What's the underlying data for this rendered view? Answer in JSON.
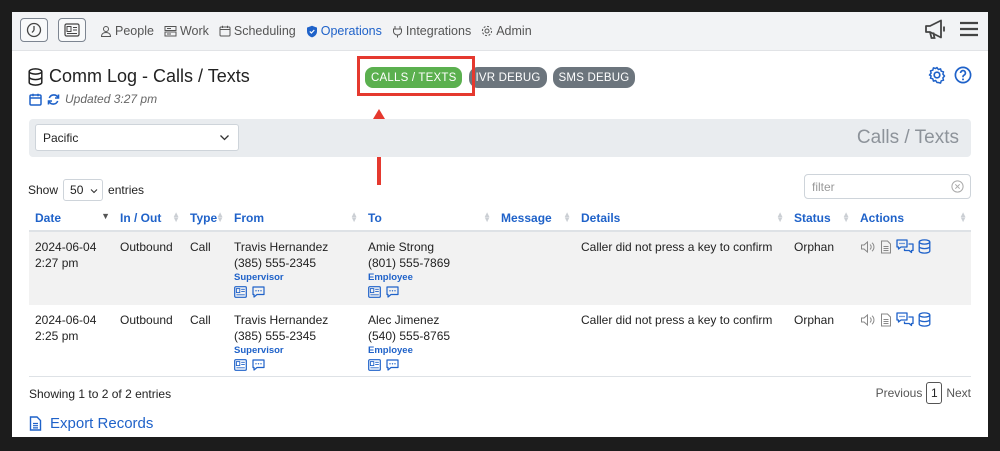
{
  "nav": {
    "items": [
      {
        "label": "People",
        "icon": "person-icon"
      },
      {
        "label": "Work",
        "icon": "work-icon"
      },
      {
        "label": "Scheduling",
        "icon": "calendar-icon"
      },
      {
        "label": "Operations",
        "icon": "shield-icon"
      },
      {
        "label": "Integrations",
        "icon": "plug-icon"
      },
      {
        "label": "Admin",
        "icon": "gear-icon"
      }
    ]
  },
  "header": {
    "title": "Comm Log - Calls / Texts",
    "updated": "Updated 3:27 pm"
  },
  "tabs": {
    "calls": "CALLS / TEXTS",
    "ivr": "IVR DEBUG",
    "sms": "SMS DEBUG"
  },
  "filterbar": {
    "timezone": "Pacific",
    "title": "Calls / Texts"
  },
  "table_controls": {
    "show": "Show",
    "page_length": "50",
    "entries": "entries",
    "filter_placeholder": "filter"
  },
  "table": {
    "columns": [
      "Date",
      "In / Out",
      "Type",
      "From",
      "To",
      "Message",
      "Details",
      "Status",
      "Actions"
    ],
    "rows": [
      {
        "date": "2024-06-04",
        "time": "2:27 pm",
        "direction": "Outbound",
        "type": "Call",
        "from_name": "Travis Hernandez",
        "from_phone": "(385) 555-2345",
        "from_role": "Supervisor",
        "to_name": "Amie Strong",
        "to_phone": "(801) 555-7869",
        "to_role": "Employee",
        "message": "",
        "details": "Caller did not press a key to confirm",
        "status": "Orphan"
      },
      {
        "date": "2024-06-04",
        "time": "2:25 pm",
        "direction": "Outbound",
        "type": "Call",
        "from_name": "Travis Hernandez",
        "from_phone": "(385) 555-2345",
        "from_role": "Supervisor",
        "to_name": "Alec Jimenez",
        "to_phone": "(540) 555-8765",
        "to_role": "Employee",
        "message": "",
        "details": "Caller did not press a key to confirm",
        "status": "Orphan"
      }
    ]
  },
  "footer": {
    "info": "Showing 1 to 2 of 2 entries",
    "previous": "Previous",
    "page": "1",
    "next": "Next",
    "export": "Export Records"
  },
  "colors": {
    "accent": "#1f62c9",
    "active_tab": "#5bb04f",
    "inactive_tab": "#6c757d",
    "highlight": "#e5392f"
  }
}
